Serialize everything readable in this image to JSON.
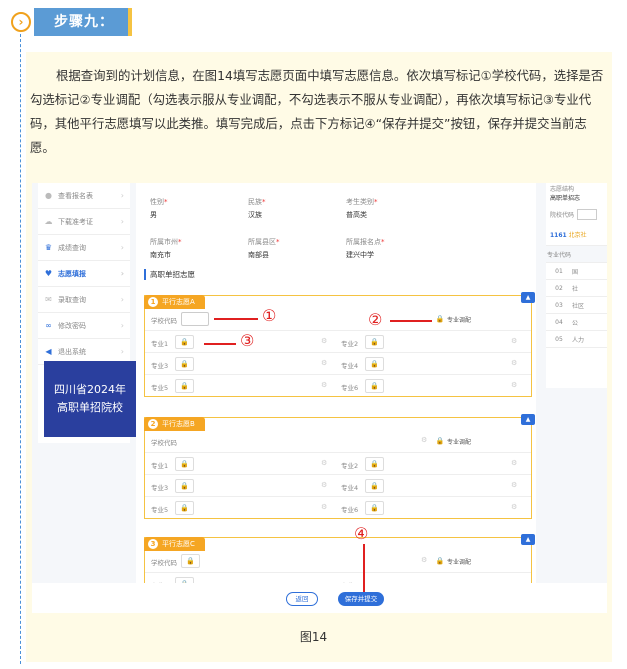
{
  "step": {
    "icon": "chevron-right-icon",
    "title": "步骤九："
  },
  "instructions": "根据查询到的计划信息，在图14填写志愿页面中填写志愿信息。依次填写标记①学校代码，选择是否勾选标记②专业调配（勾选表示服从专业调配，不勾选表示不服从专业调配），再依次填写标记③专业代码，其他平行志愿填写以此类推。填写完成后，点击下方标记④“保存并提交”按钮，保存并提交当前志愿。",
  "sidebar": {
    "items": [
      {
        "label": "查看报名表",
        "icon": "person-icon"
      },
      {
        "label": "下载准考证",
        "icon": "cloud-download-icon"
      },
      {
        "label": "成绩查询",
        "icon": "trophy-icon"
      },
      {
        "label": "志愿填报",
        "icon": "heart-icon"
      },
      {
        "label": "录取查询",
        "icon": "mail-icon"
      },
      {
        "label": "修改密码",
        "icon": "link-icon"
      },
      {
        "label": "退出系统",
        "icon": "exit-icon"
      }
    ],
    "banner_line1": "四川省2024年",
    "banner_line2": "高职单招院校"
  },
  "profile": {
    "gender_label": "性别",
    "gender": "男",
    "ethnicity_label": "民族",
    "ethnicity": "汉族",
    "category_label": "考生类别",
    "category": "普高类",
    "city_label": "所属市州",
    "city": "南充市",
    "county_label": "所属县区",
    "county": "南部县",
    "site_label": "所属报名点",
    "site": "建兴中学"
  },
  "section_title": "高职单招志愿",
  "groups": [
    {
      "num": "1",
      "title": "平行志愿A"
    },
    {
      "num": "2",
      "title": "平行志愿B"
    },
    {
      "num": "3",
      "title": "平行志愿C"
    }
  ],
  "labels": {
    "school_code": "学校代码",
    "adjust": "专业调配",
    "major1": "专业1",
    "major2": "专业2",
    "major3": "专业3",
    "major4": "专业4",
    "major5": "专业5",
    "major6": "专业6"
  },
  "right_panel": {
    "title1": "志愿结构",
    "title2": "高职单招志",
    "school_code_label": "院校代码",
    "school_id": "1161",
    "school_name": "北京社",
    "col_header": "专业代码",
    "rows": [
      {
        "code": "01",
        "name": "国"
      },
      {
        "code": "02",
        "name": "社"
      },
      {
        "code": "03",
        "name": "社区"
      },
      {
        "code": "04",
        "name": "公"
      },
      {
        "code": "05",
        "name": "人力"
      }
    ]
  },
  "buttons": {
    "back": "返回",
    "submit": "保存并提交"
  },
  "markers": {
    "m1": "①",
    "m2": "②",
    "m3": "③",
    "m4": "④"
  },
  "caption": "图14",
  "colors": {
    "accent": "#2f6fd9",
    "step_tag": "#5b9bd5",
    "group": "#f5a623",
    "marker": "#e02020"
  }
}
